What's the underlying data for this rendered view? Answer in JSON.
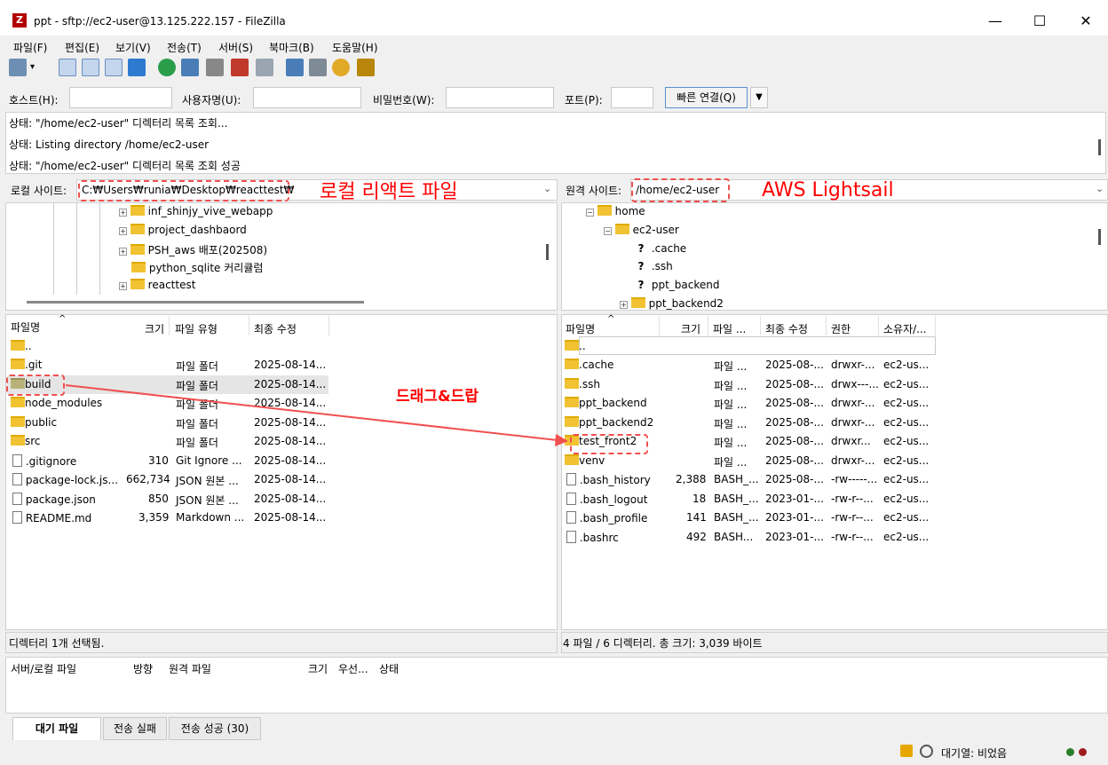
{
  "window": {
    "title": "ppt - sftp://ec2-user@13.125.222.157 - FileZilla",
    "minimize": "—",
    "maximize": "☐",
    "close": "✕",
    "app_icon": "Z"
  },
  "menu": [
    "파일(F)",
    "편집(E)",
    "보기(V)",
    "전송(T)",
    "서버(S)",
    "북마크(B)",
    "도움말(H)"
  ],
  "quickconnect": {
    "host_label": "호스트(H):",
    "user_label": "사용자명(U):",
    "pass_label": "비밀번호(W):",
    "port_label": "포트(P):",
    "button": "빠른 연결(Q)",
    "dropdown": "▼"
  },
  "log": [
    "상태: \"/home/ec2-user\" 디렉터리 목록 조회...",
    "상태: Listing directory /home/ec2-user",
    "상태: \"/home/ec2-user\" 디렉터리 목록 조회 성공"
  ],
  "local": {
    "site_label": "로컬 사이트:",
    "site_path": "C:₩Users₩runia₩Desktop₩reacttest₩",
    "tree": [
      "inf_shinjy_vive_webapp",
      "project_dashbaord",
      "PSH_aws 배포(202508)",
      "python_sqlite 커리큘럼",
      "reacttest"
    ],
    "columns": [
      "파일명",
      "크기",
      "파일 유형",
      "최종 수정"
    ],
    "files": [
      {
        "name": "..",
        "size": "",
        "type": "",
        "modified": ""
      },
      {
        "name": ".git",
        "size": "",
        "type": "파일 폴더",
        "modified": "2025-08-14..."
      },
      {
        "name": "build",
        "size": "",
        "type": "파일 폴더",
        "modified": "2025-08-14..."
      },
      {
        "name": "node_modules",
        "size": "",
        "type": "파일 폴더",
        "modified": "2025-08-14..."
      },
      {
        "name": "public",
        "size": "",
        "type": "파일 폴더",
        "modified": "2025-08-14..."
      },
      {
        "name": "src",
        "size": "",
        "type": "파일 폴더",
        "modified": "2025-08-14..."
      },
      {
        "name": ".gitignore",
        "size": "310",
        "type": "Git Ignore ...",
        "modified": "2025-08-14..."
      },
      {
        "name": "package-lock.js...",
        "size": "662,734",
        "type": "JSON 원본 ...",
        "modified": "2025-08-14..."
      },
      {
        "name": "package.json",
        "size": "850",
        "type": "JSON 원본 ...",
        "modified": "2025-08-14..."
      },
      {
        "name": "README.md",
        "size": "3,359",
        "type": "Markdown ...",
        "modified": "2025-08-14..."
      }
    ],
    "status": "디렉터리 1개 선택됨."
  },
  "remote": {
    "site_label": "원격 사이트:",
    "site_path": "/home/ec2-user",
    "tree": [
      "home",
      "ec2-user",
      ".cache",
      ".ssh",
      "ppt_backend",
      "ppt_backend2"
    ],
    "columns": [
      "파일명",
      "크기",
      "파일 ...",
      "최종 수정",
      "권한",
      "소유자/..."
    ],
    "files": [
      {
        "name": "..",
        "size": "",
        "type": "",
        "modified": "",
        "perm": "",
        "owner": ""
      },
      {
        "name": ".cache",
        "size": "",
        "type": "파일 ...",
        "modified": "2025-08-...",
        "perm": "drwxr-...",
        "owner": "ec2-us..."
      },
      {
        "name": ".ssh",
        "size": "",
        "type": "파일 ...",
        "modified": "2025-08-...",
        "perm": "drwx---...",
        "owner": "ec2-us..."
      },
      {
        "name": "ppt_backend",
        "size": "",
        "type": "파일 ...",
        "modified": "2025-08-...",
        "perm": "drwxr-...",
        "owner": "ec2-us..."
      },
      {
        "name": "ppt_backend2",
        "size": "",
        "type": "파일 ...",
        "modified": "2025-08-...",
        "perm": "drwxr-...",
        "owner": "ec2-us..."
      },
      {
        "name": "test_front2",
        "size": "",
        "type": "파일 ...",
        "modified": "2025-08-...",
        "perm": "drwxr...",
        "owner": "ec2-us..."
      },
      {
        "name": "venv",
        "size": "",
        "type": "파일 ...",
        "modified": "2025-08-...",
        "perm": "drwxr-...",
        "owner": "ec2-us..."
      },
      {
        "name": ".bash_history",
        "size": "2,388",
        "type": "BASH_...",
        "modified": "2025-08-...",
        "perm": "-rw-----...",
        "owner": "ec2-us..."
      },
      {
        "name": ".bash_logout",
        "size": "18",
        "type": "BASH_...",
        "modified": "2023-01-...",
        "perm": "-rw-r--...",
        "owner": "ec2-us..."
      },
      {
        "name": ".bash_profile",
        "size": "141",
        "type": "BASH_...",
        "modified": "2023-01-...",
        "perm": "-rw-r--...",
        "owner": "ec2-us..."
      },
      {
        "name": ".bashrc",
        "size": "492",
        "type": "BASH...",
        "modified": "2023-01-...",
        "perm": "-rw-r--...",
        "owner": "ec2-us..."
      }
    ],
    "status": "4 파일 / 6 디렉터리. 총 크기: 3,039 바이트"
  },
  "queue": {
    "columns": [
      "서버/로컬 파일",
      "방향",
      "원격 파일",
      "크기",
      "우선...",
      "상태"
    ],
    "tabs": [
      "대기 파일",
      "전송 실패",
      "전송 성공 (30)"
    ],
    "status": "대기열: 비었음"
  },
  "annotations": {
    "local_label": "로컬 리액트 파일",
    "remote_label": "AWS Lightsail",
    "drag_label": "드래그&드랍"
  }
}
